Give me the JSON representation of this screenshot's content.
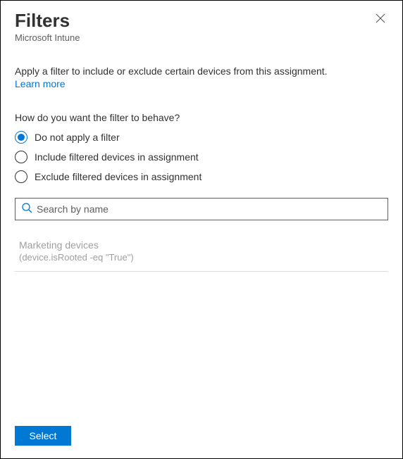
{
  "header": {
    "title": "Filters",
    "subtitle": "Microsoft Intune"
  },
  "intro": {
    "text": "Apply a filter to include or exclude certain devices from this assignment.",
    "learn_more": "Learn more"
  },
  "question": "How do you want the filter to behave?",
  "radios": [
    {
      "label": "Do not apply a filter",
      "selected": true
    },
    {
      "label": "Include filtered devices in assignment",
      "selected": false
    },
    {
      "label": "Exclude filtered devices in assignment",
      "selected": false
    }
  ],
  "search": {
    "placeholder": "Search by name",
    "value": ""
  },
  "results": [
    {
      "name": "Marketing devices",
      "rule": "(device.isRooted -eq \"True\")"
    }
  ],
  "footer": {
    "select_label": "Select"
  }
}
